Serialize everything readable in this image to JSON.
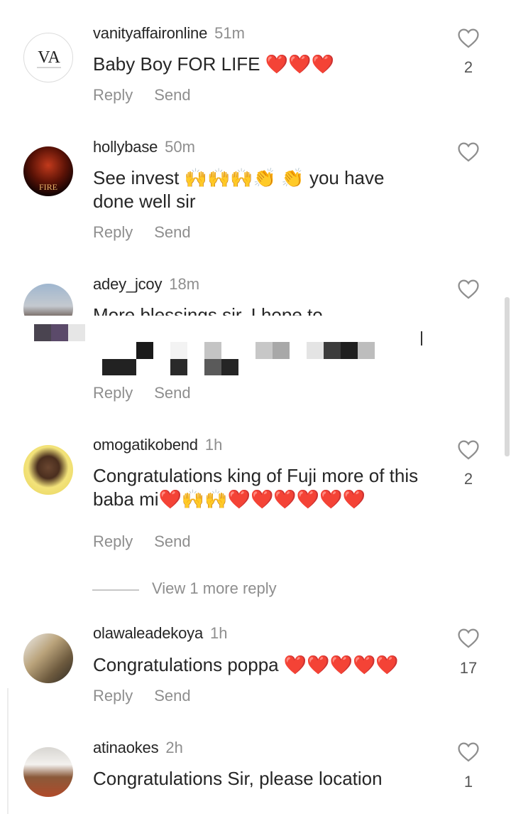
{
  "actions": {
    "reply": "Reply",
    "send": "Send"
  },
  "comments": [
    {
      "username": "vanityaffaironline",
      "time": "51m",
      "text": "Baby Boy FOR LIFE ❤️❤️❤️",
      "likes": "2",
      "avatar": "VA logo"
    },
    {
      "username": "hollybase",
      "time": "50m",
      "text": "See invest 🙌🙌🙌👏 👏 you have done well sir",
      "likes": "",
      "avatar": "poster"
    },
    {
      "username": "adey_jcoy",
      "time": "18m",
      "text": "More blessings sir. I hope to",
      "likes": "",
      "avatar": "photo"
    },
    {
      "username": "omogatikobend",
      "time": "1h",
      "text": "Congratulations king of Fuji more of this baba mi❤️🙌🙌❤️❤️❤️❤️❤️❤️",
      "likes": "2",
      "avatar": "photo"
    },
    {
      "username": "olawaleadekoya",
      "time": "1h",
      "text": "Congratulations poppa ❤️❤️❤️❤️❤️",
      "likes": "17",
      "avatar": "photo"
    },
    {
      "username": "atinaokes",
      "time": "2h",
      "text": "Congratulations Sir, please location",
      "likes": "1",
      "avatar": "photo"
    }
  ],
  "view_more": "View 1 more reply"
}
